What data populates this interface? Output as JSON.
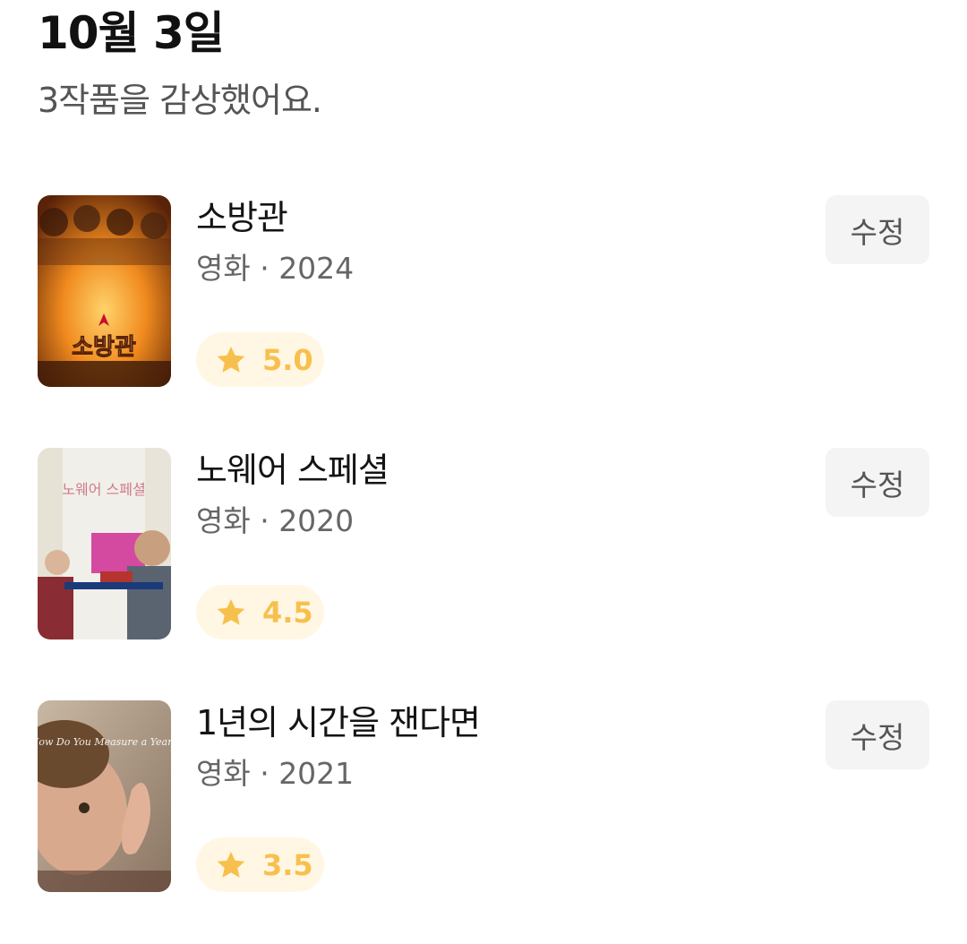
{
  "header": {
    "date": "10월 3일",
    "summary": "3작품을 감상했어요."
  },
  "items": [
    {
      "title": "소방관",
      "meta": "영화 · 2024",
      "rating": "5.0",
      "edit_label": "수정",
      "poster_text": "소방관"
    },
    {
      "title": "노웨어 스페셜",
      "meta": "영화 · 2020",
      "rating": "4.5",
      "edit_label": "수정",
      "poster_text": "노웨어 스페셜"
    },
    {
      "title": "1년의 시간을 잰다면",
      "meta": "영화 · 2021",
      "rating": "3.5",
      "edit_label": "수정",
      "poster_text": "How Do You Measure a Year?"
    }
  ],
  "icons": {
    "rating": "star-icon"
  },
  "colors": {
    "star": "#f7c04e",
    "rating_bg": "#fff7e3",
    "edit_bg": "#f4f4f4"
  }
}
